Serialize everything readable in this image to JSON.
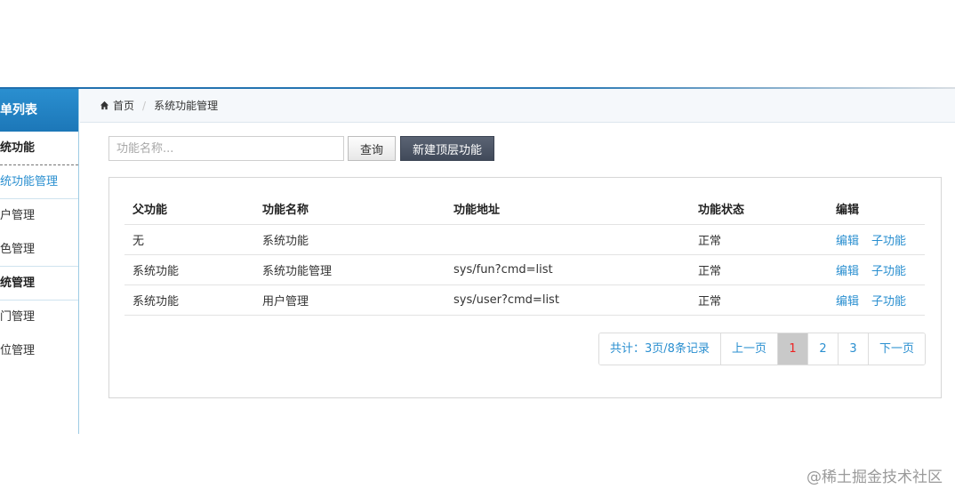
{
  "sidebar": {
    "header": "菜单列表",
    "groups": [
      {
        "label": "系统功能",
        "items": [
          "系统功能管理",
          "用户管理",
          "角色管理"
        ]
      },
      {
        "label": "系统管理",
        "items": [
          "部门管理",
          "职位管理"
        ]
      }
    ]
  },
  "breadcrumb": {
    "home": "首页",
    "current": "系统功能管理"
  },
  "search": {
    "placeholder": "功能名称...",
    "query_label": "查询",
    "new_label": "新建顶层功能"
  },
  "table": {
    "headers": [
      "父功能",
      "功能名称",
      "功能地址",
      "功能状态",
      "编辑"
    ],
    "rows": [
      {
        "parent": "无",
        "name": "系统功能",
        "url": "",
        "status": "正常",
        "edit": "编辑",
        "child": "子功能"
      },
      {
        "parent": "系统功能",
        "name": "系统功能管理",
        "url": "sys/fun?cmd=list",
        "status": "正常",
        "edit": "编辑",
        "child": "子功能"
      },
      {
        "parent": "系统功能",
        "name": "用户管理",
        "url": "sys/user?cmd=list",
        "status": "正常",
        "edit": "编辑",
        "child": "子功能"
      }
    ]
  },
  "pager": {
    "info": "共计：3页/8条记录",
    "prev": "上一页",
    "pages": [
      "1",
      "2",
      "3"
    ],
    "current": "1",
    "next": "下一页"
  },
  "watermark": "@稀土掘金技术社区",
  "colors": {
    "accent": "#2a8fd0",
    "dark_button": "#4a5363",
    "active_page_text": "#e22222"
  }
}
